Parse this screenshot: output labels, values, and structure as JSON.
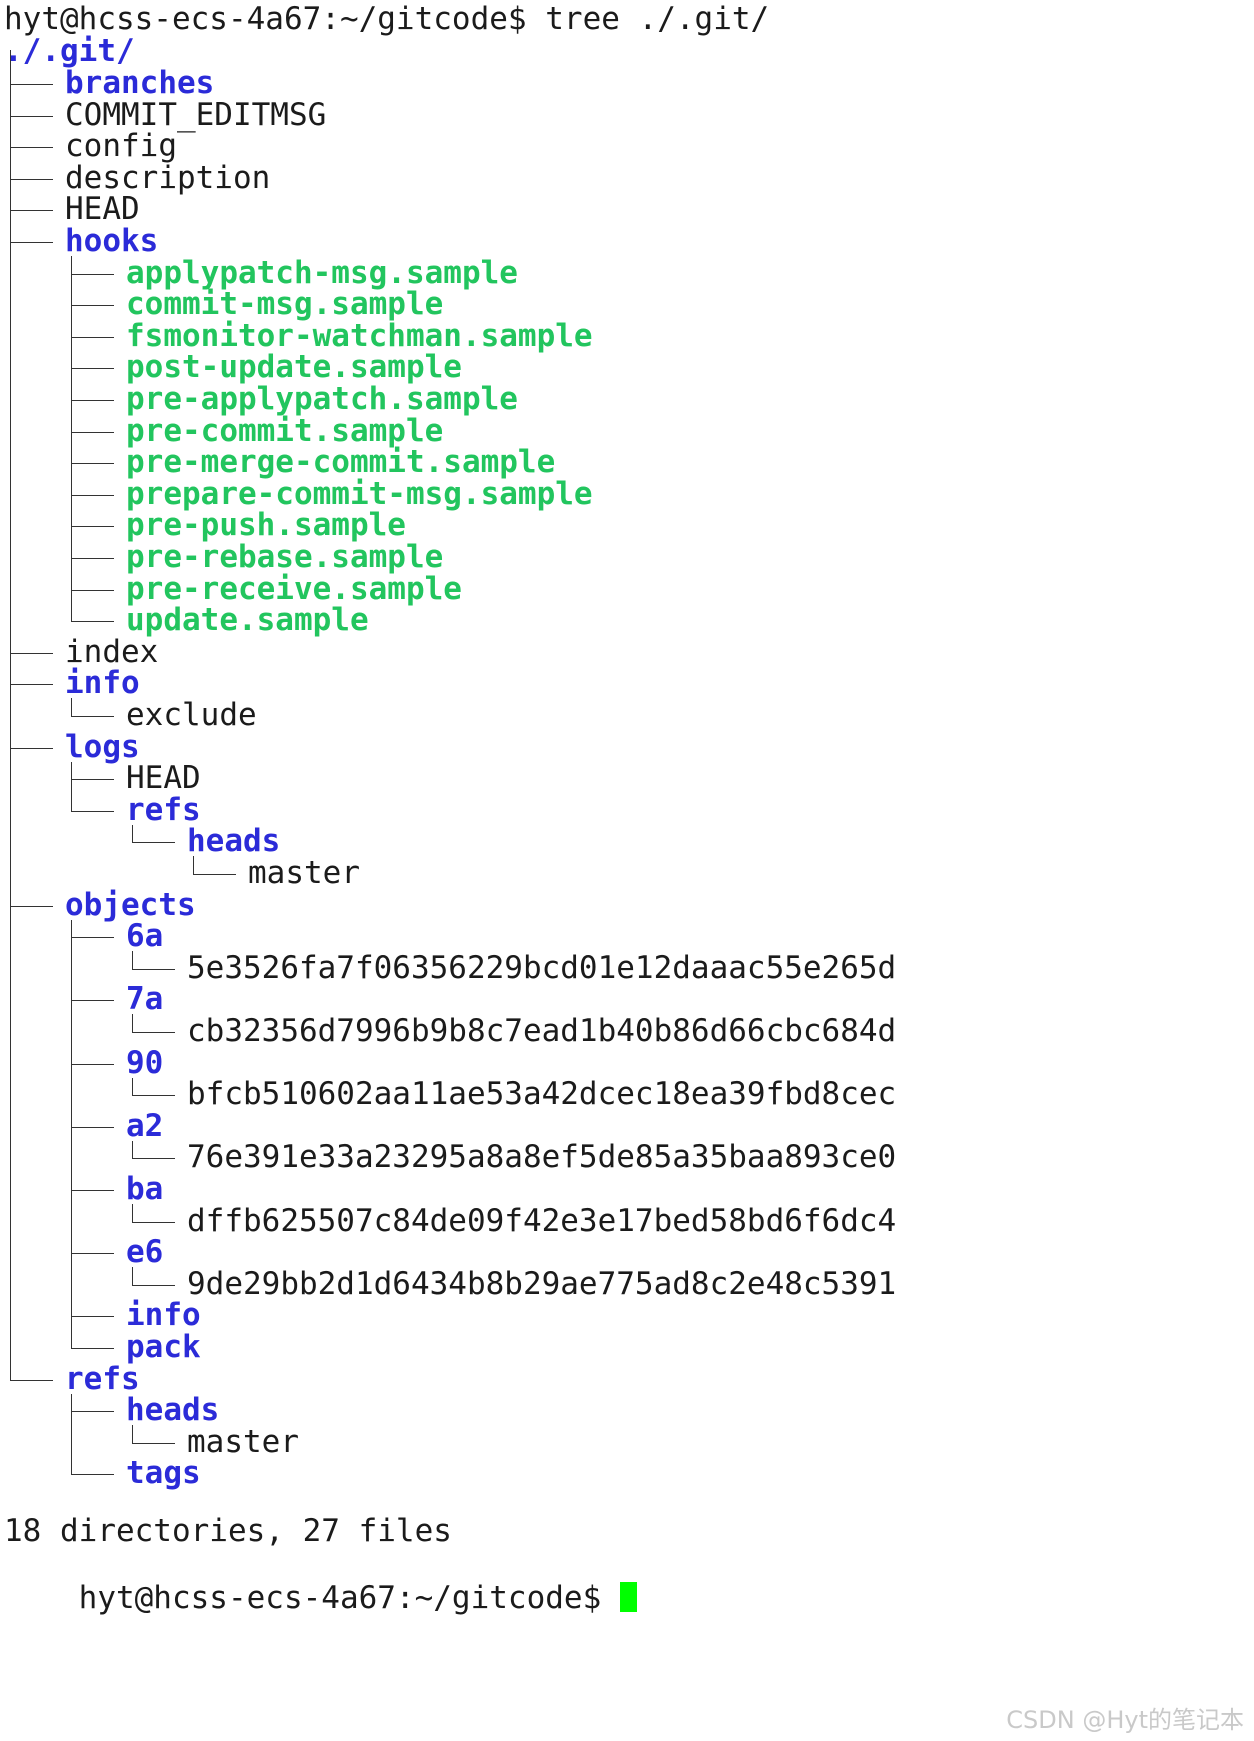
{
  "terminal": {
    "command_prompt": "hyt@hcss-ecs-4a67:~/gitcode$ tree ./.git/",
    "root": "./.git/",
    "summary": "18 directories, 27 files",
    "final_prompt": "hyt@hcss-ecs-4a67:~/gitcode$",
    "colors": {
      "directory": "#2b2bd8",
      "executable": "#22c55e",
      "file": "#1b1b1b",
      "cursor": "#00ff00"
    },
    "tree": [
      {
        "name": "branches",
        "kind": "dir",
        "depth": 1
      },
      {
        "name": "COMMIT_EDITMSG",
        "kind": "file",
        "depth": 1
      },
      {
        "name": "config",
        "kind": "file",
        "depth": 1
      },
      {
        "name": "description",
        "kind": "file",
        "depth": 1
      },
      {
        "name": "HEAD",
        "kind": "file",
        "depth": 1
      },
      {
        "name": "hooks",
        "kind": "dir",
        "depth": 1
      },
      {
        "name": "applypatch-msg.sample",
        "kind": "exe",
        "depth": 2
      },
      {
        "name": "commit-msg.sample",
        "kind": "exe",
        "depth": 2
      },
      {
        "name": "fsmonitor-watchman.sample",
        "kind": "exe",
        "depth": 2
      },
      {
        "name": "post-update.sample",
        "kind": "exe",
        "depth": 2
      },
      {
        "name": "pre-applypatch.sample",
        "kind": "exe",
        "depth": 2
      },
      {
        "name": "pre-commit.sample",
        "kind": "exe",
        "depth": 2
      },
      {
        "name": "pre-merge-commit.sample",
        "kind": "exe",
        "depth": 2
      },
      {
        "name": "prepare-commit-msg.sample",
        "kind": "exe",
        "depth": 2
      },
      {
        "name": "pre-push.sample",
        "kind": "exe",
        "depth": 2
      },
      {
        "name": "pre-rebase.sample",
        "kind": "exe",
        "depth": 2
      },
      {
        "name": "pre-receive.sample",
        "kind": "exe",
        "depth": 2
      },
      {
        "name": "update.sample",
        "kind": "exe",
        "depth": 2
      },
      {
        "name": "index",
        "kind": "file",
        "depth": 1
      },
      {
        "name": "info",
        "kind": "dir",
        "depth": 1
      },
      {
        "name": "exclude",
        "kind": "file",
        "depth": 2
      },
      {
        "name": "logs",
        "kind": "dir",
        "depth": 1
      },
      {
        "name": "HEAD",
        "kind": "file",
        "depth": 2
      },
      {
        "name": "refs",
        "kind": "dir",
        "depth": 2
      },
      {
        "name": "heads",
        "kind": "dir",
        "depth": 3
      },
      {
        "name": "master",
        "kind": "file",
        "depth": 4
      },
      {
        "name": "objects",
        "kind": "dir",
        "depth": 1
      },
      {
        "name": "6a",
        "kind": "dir",
        "depth": 2
      },
      {
        "name": "5e3526fa7f06356229bcd01e12daaac55e265d",
        "kind": "file",
        "depth": 3
      },
      {
        "name": "7a",
        "kind": "dir",
        "depth": 2
      },
      {
        "name": "cb32356d7996b9b8c7ead1b40b86d66cbc684d",
        "kind": "file",
        "depth": 3
      },
      {
        "name": "90",
        "kind": "dir",
        "depth": 2
      },
      {
        "name": "bfcb510602aa11ae53a42dcec18ea39fbd8cec",
        "kind": "file",
        "depth": 3
      },
      {
        "name": "a2",
        "kind": "dir",
        "depth": 2
      },
      {
        "name": "76e391e33a23295a8a8ef5de85a35baa893ce0",
        "kind": "file",
        "depth": 3
      },
      {
        "name": "ba",
        "kind": "dir",
        "depth": 2
      },
      {
        "name": "dffb625507c84de09f42e3e17bed58bd6f6dc4",
        "kind": "file",
        "depth": 3
      },
      {
        "name": "e6",
        "kind": "dir",
        "depth": 2
      },
      {
        "name": "9de29bb2d1d6434b8b29ae775ad8c2e48c5391",
        "kind": "file",
        "depth": 3
      },
      {
        "name": "info",
        "kind": "dir",
        "depth": 2
      },
      {
        "name": "pack",
        "kind": "dir",
        "depth": 2
      },
      {
        "name": "refs",
        "kind": "dir",
        "depth": 1
      },
      {
        "name": "heads",
        "kind": "dir",
        "depth": 2
      },
      {
        "name": "master",
        "kind": "file",
        "depth": 3
      },
      {
        "name": "tags",
        "kind": "dir",
        "depth": 2
      }
    ]
  },
  "watermark": "CSDN @Hyt的笔记本"
}
